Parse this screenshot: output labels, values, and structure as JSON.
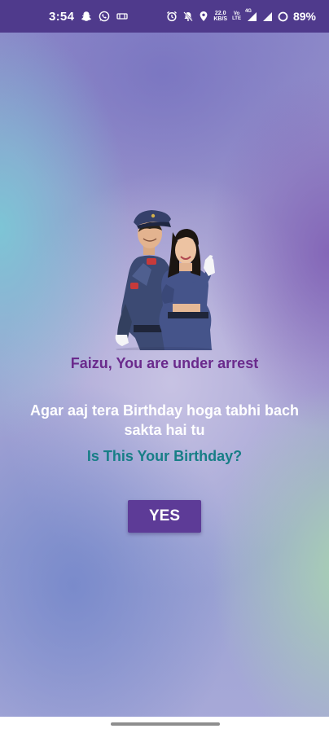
{
  "status_bar": {
    "time": "3:54",
    "left_icons": [
      "snapchat-icon",
      "whatsapp-icon",
      "cast-icon"
    ],
    "right_icons": [
      "alarm-icon",
      "mute-icon",
      "location-icon",
      "network-speed",
      "wifi-icon",
      "signal-icon",
      "battery-icon"
    ],
    "net_speed_value": "22.0",
    "net_speed_unit": "KB/S",
    "net_type_top": "Vo",
    "net_type_bottom": "LTE",
    "network_label": "4G",
    "battery": "89%"
  },
  "main": {
    "illustration_icon": "police-couple-illustration",
    "title": "Faizu, You are under arrest",
    "message": "Agar aaj tera Birthday hoga tabhi bach sakta hai tu",
    "question": "Is This Your Birthday?",
    "yes_label": "YES"
  },
  "colors": {
    "status_bar_bg": "#4f3a8c",
    "title_color": "#6a2a8c",
    "question_color": "#177e86",
    "button_bg": "#5d3b97"
  }
}
